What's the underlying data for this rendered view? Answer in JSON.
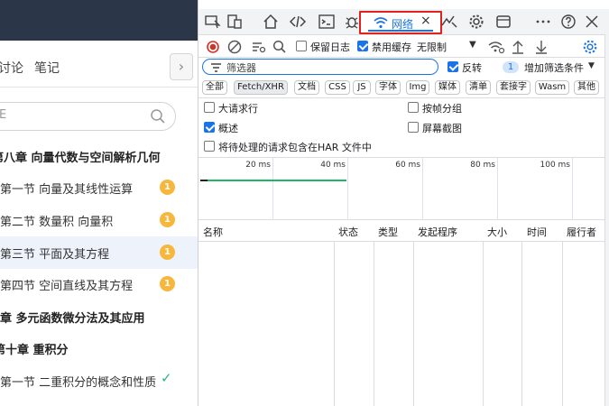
{
  "course": {
    "tabs": [
      {
        "label": "讨论"
      },
      {
        "label": "笔记"
      }
    ],
    "collapse_glyph": "›",
    "search_placeholder": "E",
    "items": [
      {
        "label": "第八章 向量代数与空间解析几何",
        "type": "chapter"
      },
      {
        "label": "第一节 向量及其线性运算",
        "type": "section",
        "badge": "1"
      },
      {
        "label": "第二节 数量积 向量积",
        "type": "section",
        "badge": "1"
      },
      {
        "label": "第三节 平面及其方程",
        "type": "section",
        "badge": "1",
        "active": true
      },
      {
        "label": "第四节 空间直线及其方程",
        "type": "section",
        "badge": "1"
      },
      {
        "label": "章 多元函数微分法及其应用",
        "type": "chapter"
      },
      {
        "label": "第十章 重积分",
        "type": "chapter"
      },
      {
        "label": "第一节 二重积分的概念和性质",
        "type": "section",
        "check": "✓"
      }
    ]
  },
  "devtools": {
    "tab_icons": [
      "device-toolbar-icon",
      "device-icon",
      "home-icon",
      "sources-icon",
      "console-icon",
      "bug-icon",
      "network-icon",
      "performance-icon",
      "settings-icon",
      "dock-icon",
      "more-icon",
      "help-icon",
      "close-icon"
    ],
    "network_tab": {
      "label": "网络",
      "close": "×"
    },
    "toolbar": {
      "preserve_log": {
        "label": "保留日志",
        "checked": false
      },
      "disable_cache": {
        "label": "禁用缓存",
        "checked": true
      },
      "throttle": "无限制"
    },
    "filter": {
      "placeholder": "筛选器",
      "invert": {
        "label": "反转",
        "checked": true
      },
      "more_filters_count": "1",
      "more_filters_label": "增加筛选条件"
    },
    "type_filters": [
      {
        "label": "全部",
        "active": false
      },
      {
        "label": "Fetch/XHR",
        "active": true
      },
      {
        "label": "文档",
        "active": false
      },
      {
        "label": "CSS",
        "active": false
      },
      {
        "label": "JS",
        "active": false
      },
      {
        "label": "字体",
        "active": false
      },
      {
        "label": "Img",
        "active": false
      },
      {
        "label": "媒体",
        "active": false
      },
      {
        "label": "清单",
        "active": false
      },
      {
        "label": "套接字",
        "active": false
      },
      {
        "label": "Wasm",
        "active": false
      },
      {
        "label": "其他",
        "active": false
      }
    ],
    "options": {
      "large_rows": {
        "label": "大请求行",
        "checked": false
      },
      "group_by_frame": {
        "label": "按帧分组",
        "checked": false
      },
      "overview": {
        "label": "概述",
        "checked": true
      },
      "screenshots": {
        "label": "屏幕截图",
        "checked": false
      },
      "har_pending": {
        "label": "将待处理的请求包含在HAR 文件中",
        "checked": false
      }
    },
    "timeline_ticks": [
      "20 ms",
      "40 ms",
      "60 ms",
      "80 ms",
      "100 ms"
    ],
    "columns": [
      "名称",
      "状态",
      "类型",
      "发起程序",
      "大小",
      "时间",
      "履行者"
    ],
    "colors": {
      "accent": "#1a73e8",
      "highlight_box": "#e2201c",
      "badge": "#f6b73c",
      "check": "#2db57f"
    }
  }
}
